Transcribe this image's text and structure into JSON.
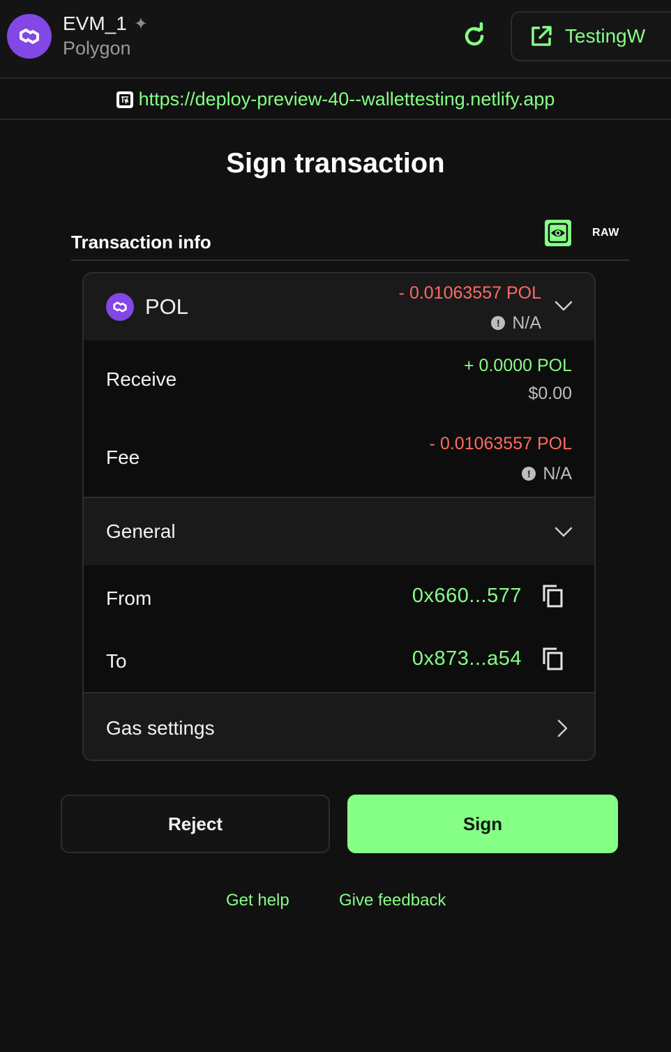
{
  "header": {
    "account_name": "EVM_1",
    "network": "Polygon",
    "dapp_button_label": "TestingW",
    "icons": [
      "polygon-logo-icon",
      "sparkle-icon",
      "refresh-icon",
      "external-link-icon"
    ]
  },
  "url_bar": {
    "url": "https://deploy-preview-40--wallettesting.netlify.app",
    "icon": "netlify-site-icon"
  },
  "page": {
    "title": "Sign transaction",
    "section_title": "Transaction info",
    "raw_label": "RAW"
  },
  "asset": {
    "symbol": "POL",
    "amount": "- 0.01063557 POL",
    "fiat": "N/A"
  },
  "receive": {
    "label": "Receive",
    "amount": "+ 0.0000 POL",
    "fiat": "$0.00"
  },
  "fee": {
    "label": "Fee",
    "amount": "- 0.01063557 POL",
    "fiat": "N/A"
  },
  "general": {
    "label": "General",
    "from_label": "From",
    "from_address": "0x660...577",
    "to_label": "To",
    "to_address": "0x873...a54"
  },
  "gas": {
    "label": "Gas settings"
  },
  "actions": {
    "reject": "Reject",
    "sign": "Sign"
  },
  "footer": {
    "help": "Get help",
    "feedback": "Give feedback"
  },
  "colors": {
    "accent_green": "#86ff86",
    "negative_red": "#ff6b61",
    "polygon_purple": "#8247e5",
    "background": "#111111"
  }
}
